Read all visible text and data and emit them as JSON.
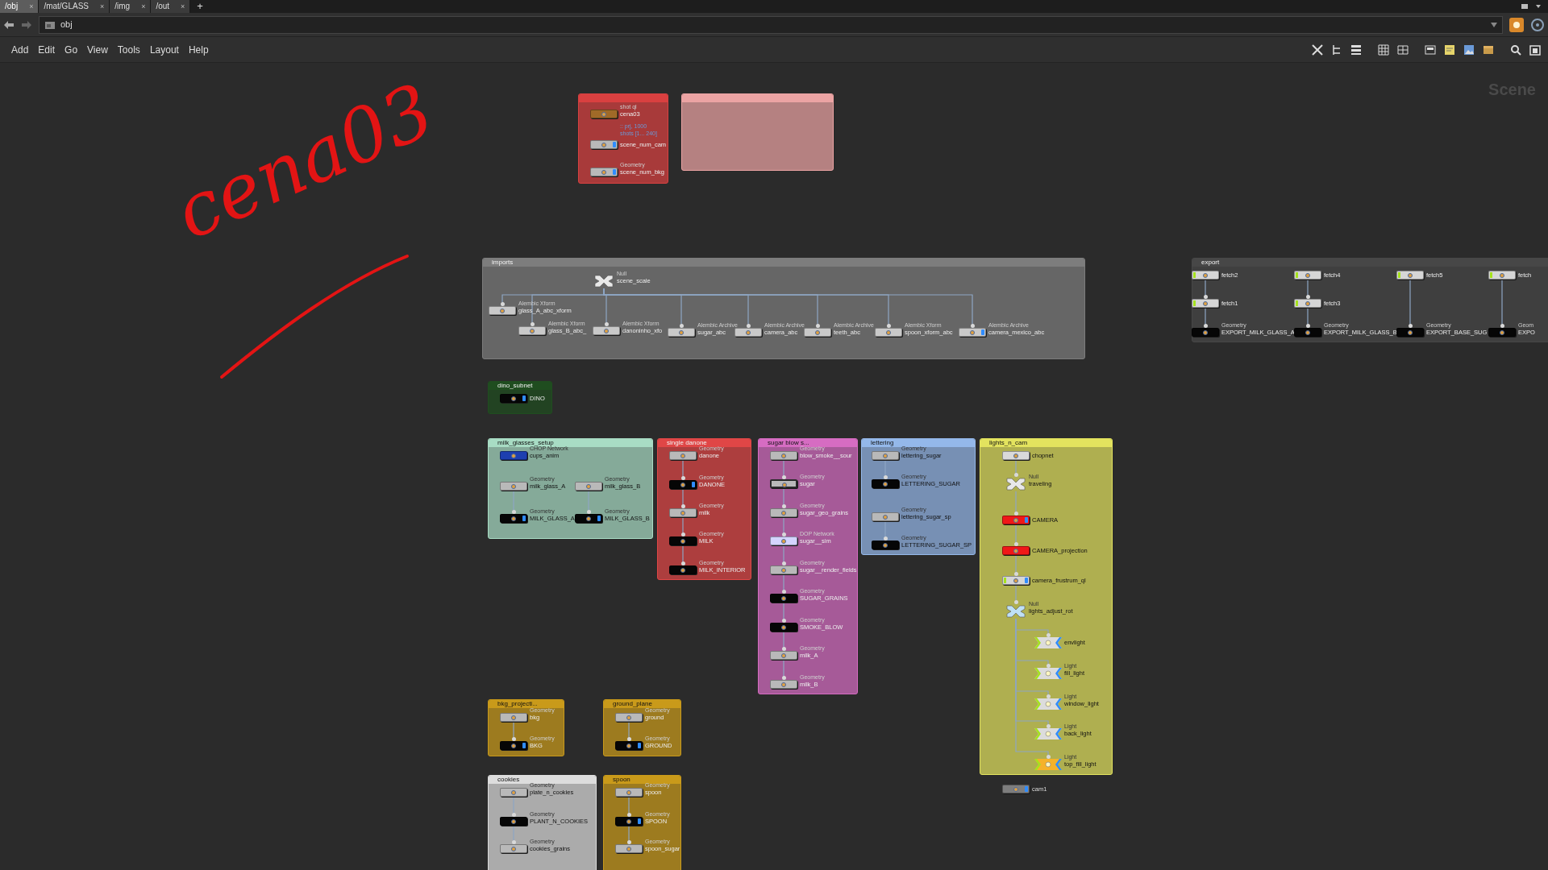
{
  "tabs": [
    {
      "label": "/obj",
      "close": "×",
      "selected": true
    },
    {
      "label": "/mat/GLASS",
      "close": "×",
      "selected": false
    },
    {
      "label": "/img",
      "close": "×",
      "selected": false
    },
    {
      "label": "/out",
      "close": "×",
      "selected": false
    }
  ],
  "new_tab": "+",
  "path": "obj",
  "menu": [
    "Add",
    "Edit",
    "Go",
    "View",
    "Tools",
    "Layout",
    "Help"
  ],
  "scene_label": "Scene",
  "sketch_note": "cena03",
  "boxes": [
    {
      "color": "#d94040",
      "nodes": [
        {
          "kind": "shot",
          "type": "shot ql",
          "name": "cena03",
          "notes": [
            ":: prj, 1000",
            "shots [1... 240]"
          ]
        },
        {
          "kind": "geo",
          "name": "scene_num_cam",
          "display": true
        },
        {
          "kind": "geo",
          "type": "Geometry",
          "name": "scene_num_bkg",
          "display": true
        }
      ]
    },
    {
      "color": "#eba3a3"
    },
    {
      "title": "imports",
      "color": "#7d7d7d",
      "nodes": [
        {
          "kind": "null",
          "type": "Null",
          "name": "scene_scale"
        },
        {
          "kind": "alembic",
          "type": "Alembic Xform",
          "name": "glass_A_abc_xform",
          "connected": true
        },
        {
          "kind": "alembic",
          "type": "Alembic Xform",
          "name": "glass_B_abc_",
          "connected": true
        },
        {
          "kind": "alembic",
          "type": "Alembic Xform",
          "name": "danoninho_xfo",
          "connected": true
        },
        {
          "kind": "alembic",
          "type": "Alembic Archive",
          "name": "sugar_abc",
          "connected": true
        },
        {
          "kind": "alembic",
          "type": "Alembic Archive",
          "name": "camera_abc",
          "connected": true
        },
        {
          "kind": "alembic",
          "type": "Alembic Archive",
          "name": "teeth_abc",
          "connected": true
        },
        {
          "kind": "alembic",
          "type": "Alembic Xform",
          "name": "spoon_xform_abc",
          "connected": true
        },
        {
          "kind": "alembic",
          "type": "Alembic Archive",
          "name": "camera_mexico_abc",
          "connected": true,
          "display": true
        }
      ]
    },
    {
      "title": "export",
      "color": "#474747",
      "nodes": [
        {
          "kind": "fetch",
          "name": "fetch2"
        },
        {
          "kind": "fetch",
          "name": "fetch4"
        },
        {
          "kind": "fetch",
          "name": "fetch5"
        },
        {
          "kind": "fetch",
          "name": "fetch"
        },
        {
          "kind": "fetch",
          "name": "fetch1",
          "connected": true
        },
        {
          "kind": "fetch",
          "name": "fetch3",
          "connected": true
        },
        {
          "kind": "output",
          "type": "Geometry",
          "name": "EXPORT_MILK_GLASS_A",
          "connected": true
        },
        {
          "kind": "output",
          "type": "Geometry",
          "name": "EXPORT_MILK_GLASS_B",
          "connected": true
        },
        {
          "kind": "output",
          "type": "Geometry",
          "name": "EXPORT_BASE_SUG",
          "connected": true
        },
        {
          "kind": "output",
          "type": "Geom",
          "name": "EXPO",
          "connected": true
        }
      ]
    },
    {
      "title": "dino_subnet",
      "color": "#1f4d1f",
      "nodes": [
        {
          "kind": "output",
          "name": "DINO",
          "display": true
        }
      ]
    },
    {
      "title": "milk_glasses_setup",
      "color": "#a8dcc4",
      "nodes": [
        {
          "kind": "chop",
          "type": "CHOP Network",
          "name": "cups_anim"
        },
        {
          "kind": "geo",
          "type": "Geometry",
          "name": "milk_glass_A"
        },
        {
          "kind": "geo",
          "type": "Geometry",
          "name": "milk_glass_B"
        },
        {
          "kind": "output",
          "type": "Geometry",
          "name": "MILK_GLASS_A",
          "connected": true,
          "display": true
        },
        {
          "kind": "output",
          "type": "Geometry",
          "name": "MILK_GLASS_B",
          "connected": true,
          "display": true
        }
      ]
    },
    {
      "title": "single danone",
      "color": "#e04646",
      "nodes": [
        {
          "kind": "geo",
          "type": "Geometry",
          "name": "danone"
        },
        {
          "kind": "output",
          "type": "Geometry",
          "name": "DANONE",
          "connected": true,
          "display": true
        },
        {
          "kind": "geo",
          "type": "Geometry",
          "name": "milk",
          "connected": true
        },
        {
          "kind": "output",
          "type": "Geometry",
          "name": "MILK",
          "connected": true
        },
        {
          "kind": "output",
          "type": "Geometry",
          "name": "MILK_INTERIOR",
          "connected": true
        }
      ]
    },
    {
      "title": "sugar blow s...",
      "color": "#d66cc2",
      "nodes": [
        {
          "kind": "geo",
          "type": "Geometry",
          "name": "blow_smoke__sour"
        },
        {
          "kind": "current",
          "type": "Geometry",
          "name": "sugar",
          "connected": true
        },
        {
          "kind": "geo",
          "type": "Geometry",
          "name": "sugar_geo_grains",
          "connected": true
        },
        {
          "kind": "dop",
          "type": "DOP Network",
          "name": "sugar__sim",
          "connected": true
        },
        {
          "kind": "geo",
          "type": "Geometry",
          "name": "sugar__render_fields",
          "connected": true
        },
        {
          "kind": "output",
          "type": "Geometry",
          "name": "SUGAR_GRAINS",
          "connected": true
        },
        {
          "kind": "output",
          "type": "Geometry",
          "name": "SMOKE_BLOW",
          "connected": true
        },
        {
          "kind": "geo",
          "type": "Geometry",
          "name": "milk_A",
          "connected": true
        },
        {
          "kind": "geo",
          "type": "Geometry",
          "name": "milk_B",
          "connected": true
        }
      ]
    },
    {
      "title": "lettering",
      "color": "#94b8ea",
      "nodes": [
        {
          "kind": "geo",
          "type": "Geometry",
          "name": "lettering_sugar"
        },
        {
          "kind": "output",
          "type": "Geometry",
          "name": "LETTERING_SUGAR",
          "connected": true
        },
        {
          "kind": "geo",
          "type": "Geometry",
          "name": "lettering_sugar_sp"
        },
        {
          "kind": "output",
          "type": "Geometry",
          "name": "LETTERING_SUGAR_SP",
          "connected": true
        }
      ]
    },
    {
      "title": "lights_n_cam",
      "color": "#e3e35e",
      "nodes": [
        {
          "kind": "chopnet",
          "name": "chopnet"
        },
        {
          "kind": "null",
          "type": "Null",
          "name": "traveling",
          "connected": true
        },
        {
          "kind": "camera",
          "name": "CAMERA",
          "connected": true,
          "display": true
        },
        {
          "kind": "camera",
          "name": "CAMERA_projection",
          "connected": true
        },
        {
          "kind": "fetch",
          "name": "camera_frustrum_ql",
          "connected": true,
          "display": true
        },
        {
          "kind": "null_blue",
          "type": "Null",
          "name": "lights_adjust_rot",
          "connected": true
        },
        {
          "kind": "light",
          "name": "envlight",
          "connected": true
        },
        {
          "kind": "light",
          "type": "Light",
          "name": "fill_light",
          "connected": true
        },
        {
          "kind": "light",
          "type": "Light",
          "name": "window_light",
          "connected": true
        },
        {
          "kind": "light",
          "type": "Light",
          "name": "back_light",
          "connected": true
        },
        {
          "kind": "light_hot",
          "type": "Light",
          "name": "top_fill_light",
          "connected": true
        }
      ]
    },
    {
      "title": "bkg_projecti...",
      "color": "#c99a1a",
      "nodes": [
        {
          "kind": "geo",
          "type": "Geometry",
          "name": "bkg"
        },
        {
          "kind": "output",
          "type": "Geometry",
          "name": "BKG",
          "connected": true,
          "display": true
        }
      ]
    },
    {
      "title": "ground_plane",
      "color": "#c99a1a",
      "nodes": [
        {
          "kind": "geo",
          "type": "Geometry",
          "name": "ground"
        },
        {
          "kind": "output",
          "type": "Geometry",
          "name": "GROUND",
          "connected": true,
          "display": true
        }
      ]
    },
    {
      "title": "cookies",
      "color": "#dddddd",
      "nodes": [
        {
          "kind": "geo",
          "type": "Geometry",
          "name": "plate_n_cookies"
        },
        {
          "kind": "output",
          "type": "Geometry",
          "name": "PLANT_N_COOKIES",
          "connected": true
        },
        {
          "kind": "geo",
          "type": "Geometry",
          "name": "cookies_grains",
          "connected": true
        }
      ]
    },
    {
      "title": "spoon",
      "color": "#c99a1a",
      "nodes": [
        {
          "kind": "geo",
          "type": "Geometry",
          "name": "spoon"
        },
        {
          "kind": "output",
          "type": "Geometry",
          "name": "SPOON",
          "connected": true,
          "display": true
        },
        {
          "kind": "geo",
          "type": "Geometry",
          "name": "spoon_sugar",
          "connected": true
        }
      ]
    }
  ],
  "loose_nodes": [
    {
      "kind": "cam",
      "name": "cam1",
      "display": true
    }
  ]
}
